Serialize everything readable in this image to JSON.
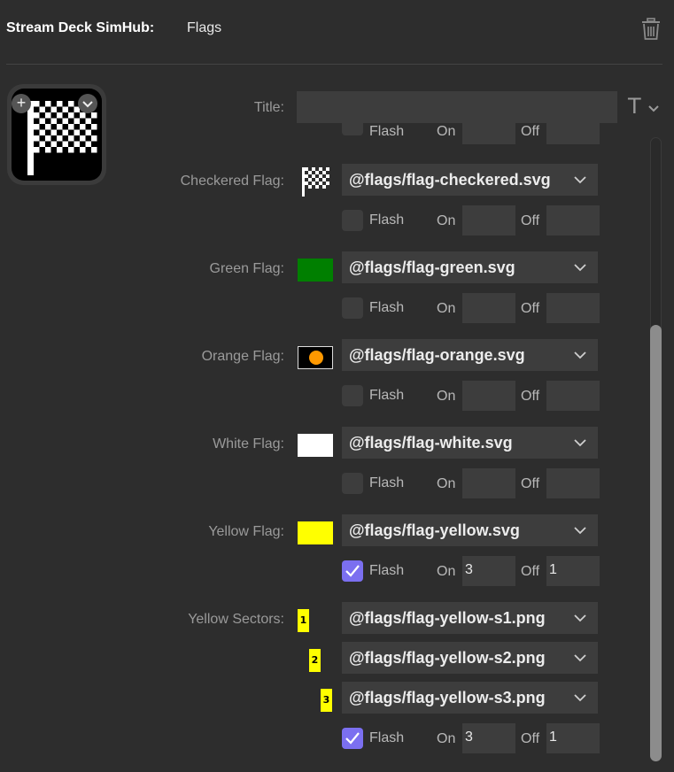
{
  "header": {
    "app_name": "Stream Deck SimHub:",
    "action_name": "Flags",
    "delete_icon": "trash-icon"
  },
  "key_preview": {
    "image": "checkered-flag-icon",
    "add_icon": "plus-icon",
    "menu_icon": "chevron-down-icon"
  },
  "title": {
    "label": "Title:",
    "value": "",
    "font_button": "T"
  },
  "cutoff_row": {
    "flash_label": "Flash",
    "on_label": "On",
    "off_label": "Off"
  },
  "flags": [
    {
      "label": "Checkered Flag:",
      "file": "@flags/flag-checkered.svg",
      "swatch": "checkered-flag-icon",
      "flash": false,
      "flash_label": "Flash",
      "on_label": "On",
      "on_value": "",
      "off_label": "Off",
      "off_value": ""
    },
    {
      "label": "Green Flag:",
      "file": "@flags/flag-green.svg",
      "swatch_color": "#007f00",
      "flash": false,
      "flash_label": "Flash",
      "on_label": "On",
      "on_value": "",
      "off_label": "Off",
      "off_value": ""
    },
    {
      "label": "Orange Flag:",
      "file": "@flags/flag-orange.svg",
      "swatch_color": "#000000",
      "swatch_dot_color": "#ff9900",
      "flash": false,
      "flash_label": "Flash",
      "on_label": "On",
      "on_value": "",
      "off_label": "Off",
      "off_value": ""
    },
    {
      "label": "White Flag:",
      "file": "@flags/flag-white.svg",
      "swatch_color": "#ffffff",
      "flash": false,
      "flash_label": "Flash",
      "on_label": "On",
      "on_value": "",
      "off_label": "Off",
      "off_value": ""
    },
    {
      "label": "Yellow Flag:",
      "file": "@flags/flag-yellow.svg",
      "swatch_color": "#ffff00",
      "flash": true,
      "flash_label": "Flash",
      "on_label": "On",
      "on_value": "3",
      "off_label": "Off",
      "off_value": "1"
    }
  ],
  "sectors": {
    "label": "Yellow Sectors:",
    "items": [
      {
        "badge": "1",
        "file": "@flags/flag-yellow-s1.png"
      },
      {
        "badge": "2",
        "file": "@flags/flag-yellow-s2.png"
      },
      {
        "badge": "3",
        "file": "@flags/flag-yellow-s3.png"
      }
    ],
    "flash": true,
    "flash_label": "Flash",
    "on_label": "On",
    "on_value": "3",
    "off_label": "Off",
    "off_value": "1"
  },
  "colors": {
    "background": "#2d2d2d",
    "control": "#3d3d3d",
    "accent": "#7b6ff0"
  }
}
